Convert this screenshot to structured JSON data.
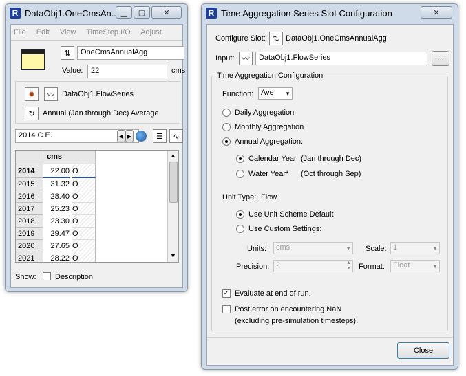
{
  "left_window": {
    "title": "DataObj1.OneCmsAn...",
    "menu": [
      "File",
      "Edit",
      "View",
      "TimeStep I/O",
      "Adjust"
    ],
    "slot_name": "OneCmsAnnualAgg",
    "value_label": "Value:",
    "value": "22",
    "value_unit": "cms",
    "source_slot": "DataObj1.FlowSeries",
    "agg_desc": "Annual (Jan through Dec) Average",
    "date": "2014 C.E.",
    "table": {
      "col_header": "cms",
      "rows": [
        {
          "year": "2014",
          "value": "22.00",
          "flag": "O"
        },
        {
          "year": "2015",
          "value": "31.32",
          "flag": "O"
        },
        {
          "year": "2016",
          "value": "28.40",
          "flag": "O"
        },
        {
          "year": "2017",
          "value": "25.23",
          "flag": "O"
        },
        {
          "year": "2018",
          "value": "23.30",
          "flag": "O"
        },
        {
          "year": "2019",
          "value": "29.47",
          "flag": "O"
        },
        {
          "year": "2020",
          "value": "27.65",
          "flag": "O"
        },
        {
          "year": "2021",
          "value": "28.22",
          "flag": "O"
        }
      ]
    },
    "show_label": "Show:",
    "description_label": "Description"
  },
  "right_window": {
    "title": "Time Aggregation Series Slot Configuration",
    "configure_label": "Configure Slot:",
    "configure_value": "DataObj1.OneCmsAnnualAgg",
    "input_label": "Input:",
    "input_value": "DataObj1.FlowSeries",
    "browse_label": "...",
    "group_title": "Time Aggregation Configuration",
    "function_label": "Function:",
    "function_value": "Ave",
    "daily": "Daily Aggregation",
    "monthly": "Monthly Aggregation",
    "annual": "Annual Aggregation:",
    "calendar_year": "Calendar Year",
    "calendar_range": "(Jan through Dec)",
    "water_year": "Water Year*",
    "water_range": "(Oct through Sep)",
    "unit_type_label": "Unit Type:",
    "unit_type_value": "Flow",
    "use_default": "Use Unit Scheme Default",
    "use_custom": "Use Custom Settings:",
    "units_label": "Units:",
    "units_value": "cms",
    "scale_label": "Scale:",
    "scale_value": "1",
    "precision_label": "Precision:",
    "precision_value": "2",
    "format_label": "Format:",
    "format_value": "Float",
    "evaluate_label": "Evaluate at end of run.",
    "post_error_label": "Post error on encountering NaN",
    "post_error_sub": "(excluding pre-simulation timesteps).",
    "close_label": "Close"
  }
}
